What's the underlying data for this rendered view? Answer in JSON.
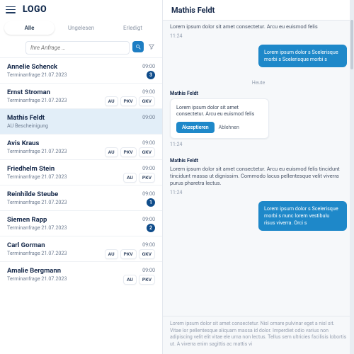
{
  "brand": "LOGO",
  "tabs": {
    "all": "Alle",
    "unread": "Ungelesen",
    "done": "Erledigt",
    "active_index": 0
  },
  "search": {
    "placeholder": "Ihre Anfrage …"
  },
  "inbox": [
    {
      "name": "Annelie Schenck",
      "sub": "Terminanfrage 21.07.2023",
      "time": "09:00",
      "right_type": "badge",
      "badge": "3"
    },
    {
      "name": "Ernst Stroman",
      "sub": "Terminanfrage 21.07.2023",
      "time": "09:00",
      "right_type": "chips",
      "chips": [
        "AU",
        "PKV",
        "GKV"
      ]
    },
    {
      "name": "Mathis Feldt",
      "sub": "AU Bescheinigung",
      "time": "09:00",
      "right_type": "none",
      "active": true
    },
    {
      "name": "Avis Kraus",
      "sub": "Terminanfrage 21.07.2023",
      "time": "09:00",
      "right_type": "chips",
      "chips": [
        "AU",
        "PKV",
        "GKV"
      ]
    },
    {
      "name": "Friedhelm Stein",
      "sub": "Terminanfrage 21.07.2023",
      "time": "09:00",
      "right_type": "chips",
      "chips": [
        "AU",
        "PKV"
      ]
    },
    {
      "name": "Reinhilde Steube",
      "sub": "Terminanfrage 21.07.2023",
      "time": "09:00",
      "right_type": "badge",
      "badge": "1"
    },
    {
      "name": "Siemen Rapp",
      "sub": "Terminanfrage 21.07.2023",
      "time": "09:00",
      "right_type": "badge",
      "badge": "2"
    },
    {
      "name": "Carl Gorman",
      "sub": "Terminanfrage 21.07.2023",
      "time": "09:00",
      "right_type": "chips",
      "chips": [
        "AU",
        "PKV",
        "GKV"
      ]
    },
    {
      "name": "Amalie Bergmann",
      "sub": "Terminanfrage 21.07.2023",
      "time": "09:00",
      "right_type": "chips",
      "chips": [
        "AU",
        "PKV"
      ]
    }
  ],
  "conversation": {
    "with": "Mathis Feldt",
    "header_snippet": "Lorem ipsum dolor sit amet consectetur. Arcu eu euismod felis",
    "header_time": "11:24",
    "outgoing1": "Lorem ipsum dolor s Scelerisque morbi s Scelerisque morbi s",
    "date_divider": "Heute",
    "incoming_name": "Mathis Feldt",
    "incoming_card_text": "Lorem ipsum dolor sit amet consectetur. Arcu eu euismod felis",
    "accept": "Akzeptieren",
    "decline": "Ablehnen",
    "card_time": "11:24",
    "incoming_name2": "Mathis Feldt",
    "plain2": "Lorem ipsum dolor sit amet consectetur. Arcu eu euismod felis tincidunt tincidunt massa ut dignissim. Commodo lacus pellentesque velit viverra purus pharetra lectus.",
    "plain2_time": "11:24",
    "outgoing2": "Lorem ipsum dolor s Scelerisque morbi s nunc lorem vestibulu risus viverra. Orci s",
    "footer": "Lorem ipsum dolor sit amet consectetur. Nisl ornare pulvinar eget a nisl sit. Vitae lor pellentesque aliquam massa id dolor. Imperdiet odio varius non adipiscing velit elit vitae ele urna non lectus. Tellus sem ultricies facilisis lobortis ut. A viverra enim sagittis ac mattis vi"
  },
  "colors": {
    "accent": "#1e88c9",
    "navy": "#0f4c8a",
    "text": "#16294a"
  }
}
